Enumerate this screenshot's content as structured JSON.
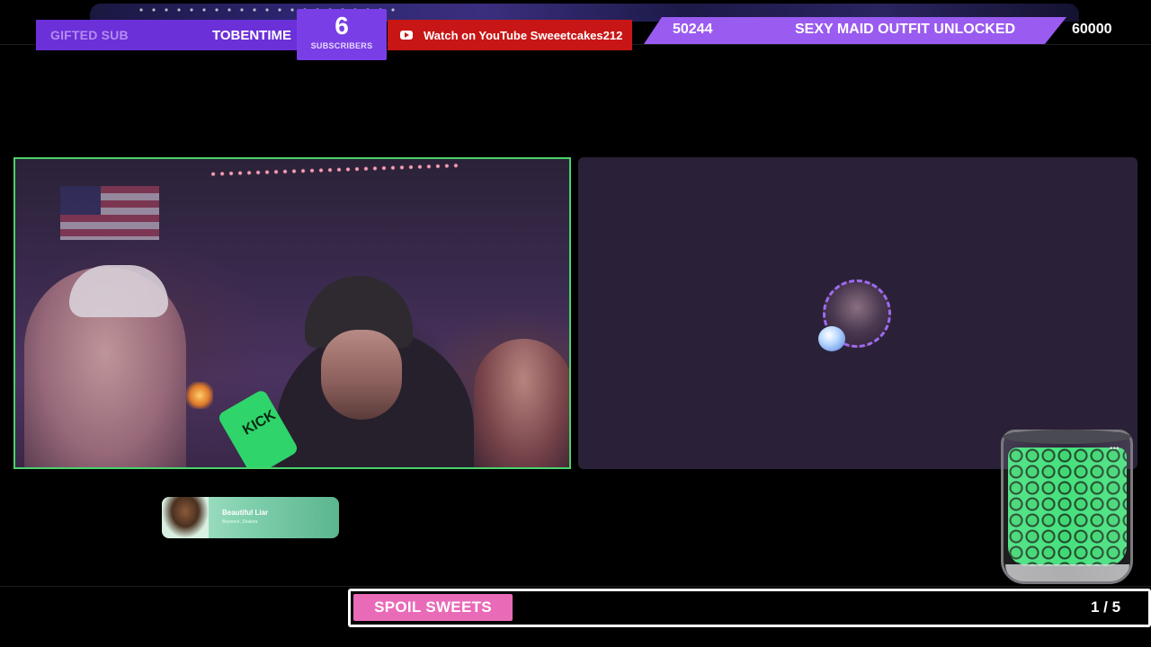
{
  "top_bar": {
    "sub_alert": {
      "type": "GIFTED SUB",
      "name": "TOBENTIME"
    },
    "subscribers": {
      "count": "6",
      "label": "SUBSCRIBERS"
    },
    "youtube": {
      "text": "Watch on YouTube Sweeetcakes212",
      "icon": "youtube-icon"
    },
    "goal": {
      "current": "50244",
      "label": "SEXY MAID OUTFIT UNLOCKED",
      "target": "60000"
    }
  },
  "webcam": {
    "border_color": "#49d36b",
    "mic_text": "KICK"
  },
  "right_panel": {
    "avatar": "user-avatar"
  },
  "music": {
    "title": "Beautiful Liar",
    "artist": "Beyoncé, Shakira"
  },
  "jar": {
    "icon": "kick-logo-jar"
  },
  "bottom_bar": {
    "button_label": "SPOIL SWEETS",
    "count": "1 / 5",
    "button_color": "#e96bb8"
  },
  "colors": {
    "purple": "#6b30d8",
    "goal_purple": "#9a5bf0",
    "youtube_red": "#c81616",
    "green": "#49d36b"
  }
}
